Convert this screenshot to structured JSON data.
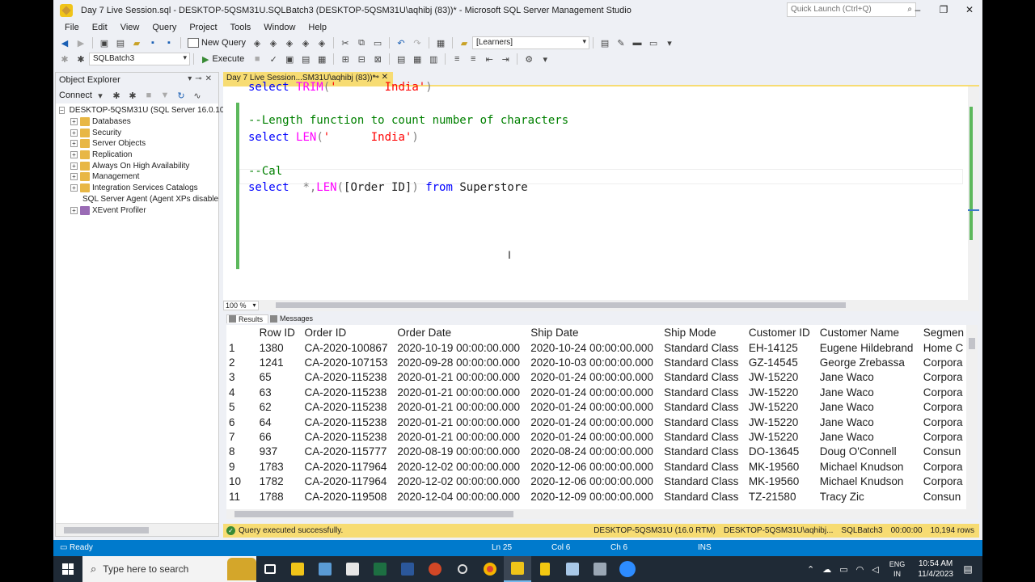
{
  "window": {
    "title": "Day 7 Live Session.sql - DESKTOP-5QSM31U.SQLBatch3 (DESKTOP-5QSM31U\\aqhibj (83))* - Microsoft SQL Server Management Studio",
    "quick_launch_placeholder": "Quick Launch (Ctrl+Q)",
    "minimize": "–",
    "restore": "❐",
    "close": "✕"
  },
  "menu": [
    "File",
    "Edit",
    "View",
    "Query",
    "Project",
    "Tools",
    "Window",
    "Help"
  ],
  "toolbar": {
    "new_query": "New Query",
    "database_combo": "[Learners]",
    "batch_combo": "SQLBatch3",
    "execute": "Execute"
  },
  "object_explorer": {
    "title": "Object Explorer",
    "connect": "Connect",
    "server": "DESKTOP-5QSM31U (SQL Server 16.0.10",
    "nodes": [
      "Databases",
      "Security",
      "Server Objects",
      "Replication",
      "Always On High Availability",
      "Management",
      "Integration Services Catalogs",
      "SQL Server Agent (Agent XPs disable",
      "XEvent Profiler"
    ]
  },
  "doc_tab": {
    "label": "Day 7 Live Session...SM31U\\aqhibj (83))*",
    "pin": "⊸",
    "close": "✕"
  },
  "editor": {
    "line1": {
      "kw": "select",
      "fn": "TRIM",
      "open": "(",
      "str": "'       India'",
      "close": ")"
    },
    "comment1": "--Length function to count number of characters",
    "line2": {
      "kw": "select",
      "fn": "LEN",
      "open": "(",
      "str": "'      India'",
      "close": ")"
    },
    "comment2": "--Cal",
    "line3": {
      "kw": "select",
      "sp": "  ",
      "star": "*,",
      "fn": "LEN",
      "open": "(",
      "col": "[Order ID]",
      "close": ")",
      "from_kw": "from",
      "table": "Superstore"
    },
    "zoom": "100 %"
  },
  "results_tabs": {
    "results": "Results",
    "messages": "Messages"
  },
  "grid": {
    "columns": [
      "",
      "Row ID",
      "Order ID",
      "Order Date",
      "Ship Date",
      "Ship Mode",
      "Customer ID",
      "Customer Name",
      "Segmen"
    ],
    "rows": [
      [
        "1",
        "1380",
        "CA-2020-100867",
        "2020-10-19 00:00:00.000",
        "2020-10-24 00:00:00.000",
        "Standard Class",
        "EH-14125",
        "Eugene Hildebrand",
        "Home C"
      ],
      [
        "2",
        "1241",
        "CA-2020-107153",
        "2020-09-28 00:00:00.000",
        "2020-10-03 00:00:00.000",
        "Standard Class",
        "GZ-14545",
        "George Zrebassa",
        "Corpora"
      ],
      [
        "3",
        "65",
        "CA-2020-115238",
        "2020-01-21 00:00:00.000",
        "2020-01-24 00:00:00.000",
        "Standard Class",
        "JW-15220",
        "Jane Waco",
        "Corpora"
      ],
      [
        "4",
        "63",
        "CA-2020-115238",
        "2020-01-21 00:00:00.000",
        "2020-01-24 00:00:00.000",
        "Standard Class",
        "JW-15220",
        "Jane Waco",
        "Corpora"
      ],
      [
        "5",
        "62",
        "CA-2020-115238",
        "2020-01-21 00:00:00.000",
        "2020-01-24 00:00:00.000",
        "Standard Class",
        "JW-15220",
        "Jane Waco",
        "Corpora"
      ],
      [
        "6",
        "64",
        "CA-2020-115238",
        "2020-01-21 00:00:00.000",
        "2020-01-24 00:00:00.000",
        "Standard Class",
        "JW-15220",
        "Jane Waco",
        "Corpora"
      ],
      [
        "7",
        "66",
        "CA-2020-115238",
        "2020-01-21 00:00:00.000",
        "2020-01-24 00:00:00.000",
        "Standard Class",
        "JW-15220",
        "Jane Waco",
        "Corpora"
      ],
      [
        "8",
        "937",
        "CA-2020-115777",
        "2020-08-19 00:00:00.000",
        "2020-08-24 00:00:00.000",
        "Standard Class",
        "DO-13645",
        "Doug O'Connell",
        "Consun"
      ],
      [
        "9",
        "1783",
        "CA-2020-117964",
        "2020-12-02 00:00:00.000",
        "2020-12-06 00:00:00.000",
        "Standard Class",
        "MK-19560",
        "Michael Knudson",
        "Corpora"
      ],
      [
        "10",
        "1782",
        "CA-2020-117964",
        "2020-12-02 00:00:00.000",
        "2020-12-06 00:00:00.000",
        "Standard Class",
        "MK-19560",
        "Michael Knudson",
        "Corpora"
      ],
      [
        "11",
        "1788",
        "CA-2020-119508",
        "2020-12-04 00:00:00.000",
        "2020-12-09 00:00:00.000",
        "Standard Class",
        "TZ-21580",
        "Tracy Zic",
        "Consun"
      ]
    ]
  },
  "query_status": {
    "message": "Query executed successfully.",
    "server": "DESKTOP-5QSM31U (16.0 RTM)",
    "user": "DESKTOP-5QSM31U\\aqhibj...",
    "batch": "SQLBatch3",
    "elapsed": "00:00:00",
    "rows": "10,194 rows"
  },
  "status_bar": {
    "ready": "Ready",
    "ln": "Ln 25",
    "col": "Col 6",
    "ch": "Ch 6",
    "ins": "INS"
  },
  "taskbar": {
    "search_placeholder": "Type here to search",
    "lang1": "ENG",
    "lang2": "IN",
    "time": "10:54 AM",
    "date": "11/4/2023"
  }
}
